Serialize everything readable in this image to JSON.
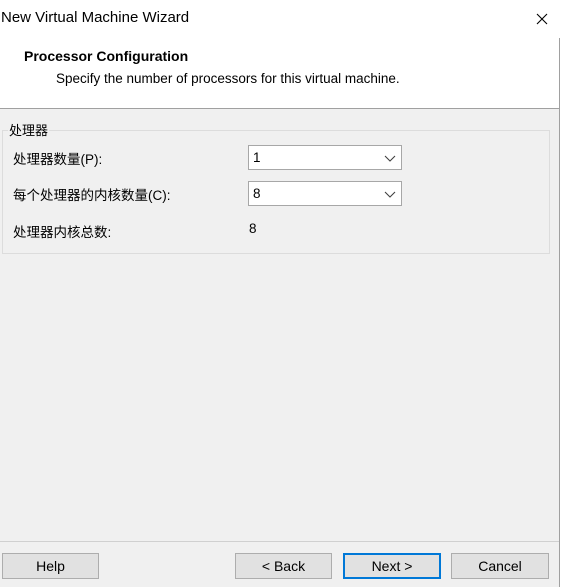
{
  "window": {
    "title": "New Virtual Machine Wizard",
    "close_glyph": "✕"
  },
  "header": {
    "title": "Processor Configuration",
    "subtitle": "Specify the number of processors for this virtual machine."
  },
  "group": {
    "label": "处理器",
    "rows": [
      {
        "label": "处理器数量(P):",
        "value": "1"
      },
      {
        "label": "每个处理器的内核数量(C):",
        "value": "8"
      },
      {
        "label": "处理器内核总数:",
        "value": "8"
      }
    ]
  },
  "buttons": {
    "help": "Help",
    "back": "< Back",
    "next": "Next >",
    "cancel": "Cancel"
  },
  "colors": {
    "accent": "#0078d7",
    "dialog_bg": "#f0f0f0",
    "button_bg": "#e1e1e1"
  },
  "icons": {
    "close": "close-icon",
    "dropdown": "chevron-down-icon"
  }
}
